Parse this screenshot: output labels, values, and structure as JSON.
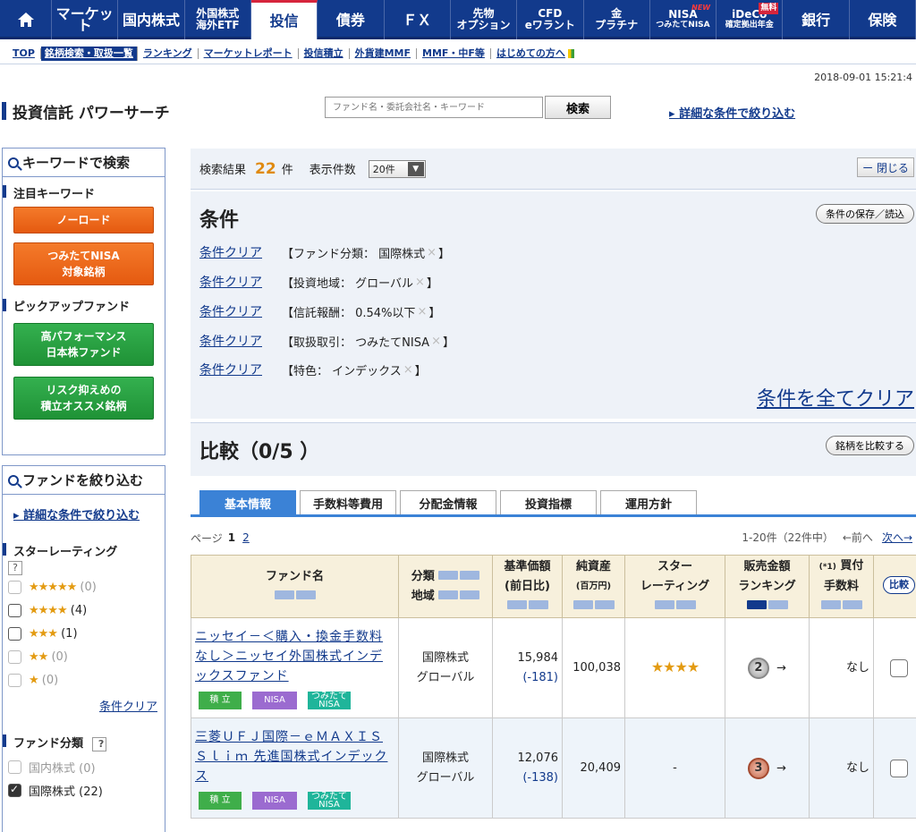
{
  "nav": {
    "items": [
      {
        "label": "マーケット"
      },
      {
        "label": "国内株式"
      },
      {
        "label": "外国株式",
        "sub": "海外ETF"
      },
      {
        "label": "投信"
      },
      {
        "label": "債券"
      },
      {
        "label": "ＦＸ"
      },
      {
        "label": "先物",
        "sub": "オプション"
      },
      {
        "label": "CFD",
        "sub": "eワラント"
      },
      {
        "label": "金",
        "sub": "プラチナ"
      },
      {
        "label": "NISA",
        "sub": "つみたてNISA",
        "badge": "NEW"
      },
      {
        "label": "iDeCo",
        "sub": "確定拠出年金",
        "badge": "無料"
      },
      {
        "label": "銀行"
      },
      {
        "label": "保険"
      }
    ]
  },
  "subnav": [
    "TOP",
    "銘柄検索・取扱一覧",
    "ランキング",
    "マーケットレポート",
    "投信積立",
    "外貨建MMF",
    "MMF・中F等",
    "はじめての方へ"
  ],
  "timestamp": "2018-09-01 15:21:4",
  "header": {
    "title": "投資信託 パワーサーチ",
    "search_placeholder": "ファンド名・委託会社名・キーワード",
    "search_button": "検索",
    "advanced_link": "詳細な条件で絞り込む"
  },
  "sidebar": {
    "keyword_title": "キーワードで検索",
    "featured_label": "注目キーワード",
    "featured_buttons": [
      "ノーロード",
      "つみたてNISA\n対象銘柄"
    ],
    "pickup_label": "ピックアップファンド",
    "pickup_buttons": [
      "高パフォーマンス\n日本株ファンド",
      "リスク抑えめの\n積立オススメ銘柄"
    ],
    "filter_title": "ファンドを絞り込む",
    "filter_link": "詳細な条件で絞り込む",
    "star_label": "スターレーティング",
    "help": "?",
    "star_rows": [
      {
        "stars": "★★★★★",
        "count": "(0)",
        "enabled": false
      },
      {
        "stars": "★★★★",
        "count": "(4)",
        "enabled": true
      },
      {
        "stars": "★★★",
        "count": "(1)",
        "enabled": true
      },
      {
        "stars": "★★",
        "count": "(0)",
        "enabled": false
      },
      {
        "stars": "★",
        "count": "(0)",
        "enabled": false
      }
    ],
    "clear_label": "条件クリア",
    "category_label": "ファンド分類",
    "category_rows": [
      {
        "label": "国内株式 (0)",
        "checked": false,
        "enabled": false
      },
      {
        "label": "国際株式 (22)",
        "checked": true,
        "enabled": true
      }
    ]
  },
  "results": {
    "label": "検索結果",
    "count": "22",
    "unit": "件",
    "per_page_label": "表示件数",
    "per_page_value": "20件",
    "close_label": "ー 閉じる"
  },
  "conditions": {
    "heading": "条件",
    "save_button": "条件の保存／読込",
    "clear_label": "条件クリア",
    "rows": [
      "【ファンド分類： 国際株式",
      "【投資地域： グローバル",
      "【信託報酬： 0.54%以下",
      "【取扱取引： つみたてNISA",
      "【特色： インデックス"
    ],
    "x": "×",
    "close_bracket": "】",
    "clear_all": "条件を全てクリア"
  },
  "compare": {
    "heading": "比較（0/5 ）",
    "button": "銘柄を比較する"
  },
  "tabs": [
    "基本情報",
    "手数料等費用",
    "分配金情報",
    "投資指標",
    "運用方針"
  ],
  "pager": {
    "label": "ページ",
    "current": "1",
    "next_page": "2",
    "range": "1-20件（22件中）",
    "prev": "←前へ",
    "next": "次へ→"
  },
  "table": {
    "headers": {
      "fund_name": "ファンド名",
      "category": "分類",
      "region": "地域",
      "nav_price": "基準価額",
      "nav_change": "(前日比)",
      "assets": "純資産",
      "assets_unit": "(百万円)",
      "rating_1": "スター",
      "rating_2": "レーティング",
      "sales_1": "販売金額",
      "sales_2": "ランキング",
      "fee_note": "(*1)",
      "fee_1": "買付",
      "fee_2": "手数料",
      "compare": "比較"
    },
    "rows": [
      {
        "name": "ニッセイ－＜購入・換金手数料なし＞ニッセイ外国株式インデックスファンド",
        "category": "国際株式",
        "region": "グローバル",
        "price": "15,984",
        "change": "(-181)",
        "assets": "100,038",
        "rating": "★★★★",
        "rank": "2",
        "arrow": "→",
        "fee": "なし",
        "tags": [
          "積 立",
          "NISA",
          "つみたて\nNISA"
        ]
      },
      {
        "name": "三菱ＵＦＪ国際－ｅＭＡＸＩＳ Ｓｌｉｍ 先進国株式インデックス",
        "category": "国際株式",
        "region": "グローバル",
        "price": "12,076",
        "change": "(-138)",
        "assets": "20,409",
        "rating": "-",
        "rank": "3",
        "arrow": "→",
        "fee": "なし",
        "tags": [
          "積 立",
          "NISA",
          "つみたて\nNISA"
        ]
      }
    ]
  }
}
